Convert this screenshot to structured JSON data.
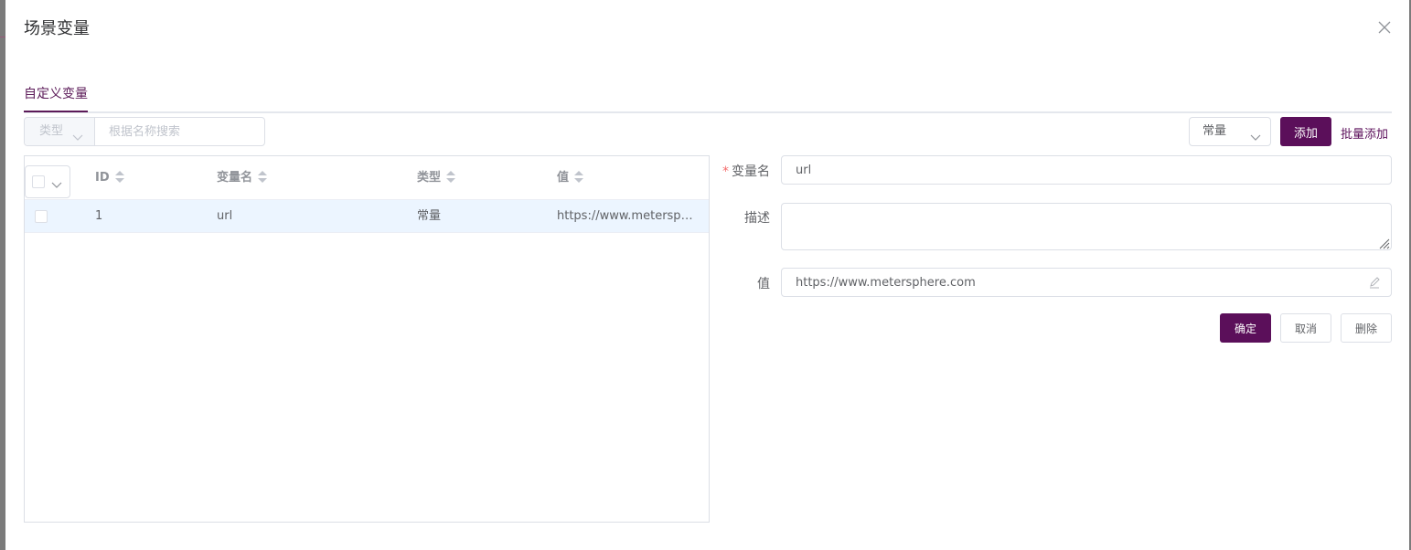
{
  "dialog": {
    "title": "场景变量"
  },
  "tabs": [
    {
      "label": "自定义变量"
    }
  ],
  "filter": {
    "type_placeholder": "类型",
    "search_placeholder": "根据名称搜索"
  },
  "toolbar": {
    "type_value": "常量",
    "add_label": "添加",
    "batch_add_label": "批量添加"
  },
  "table": {
    "columns": [
      "ID",
      "变量名",
      "类型",
      "值"
    ],
    "rows": [
      {
        "id": "1",
        "name": "url",
        "type": "常量",
        "value": "https://www.metersphere.com"
      }
    ]
  },
  "form": {
    "name_label": "变量名",
    "name_value": "url",
    "desc_label": "描述",
    "desc_value": "",
    "value_label": "值",
    "value_value": "https://www.metersphere.com",
    "confirm_label": "确定",
    "cancel_label": "取消",
    "delete_label": "删除"
  },
  "colors": {
    "primary": "#5b0f5a",
    "required": "#f56c6c",
    "row_highlight": "#ecf5ff"
  }
}
